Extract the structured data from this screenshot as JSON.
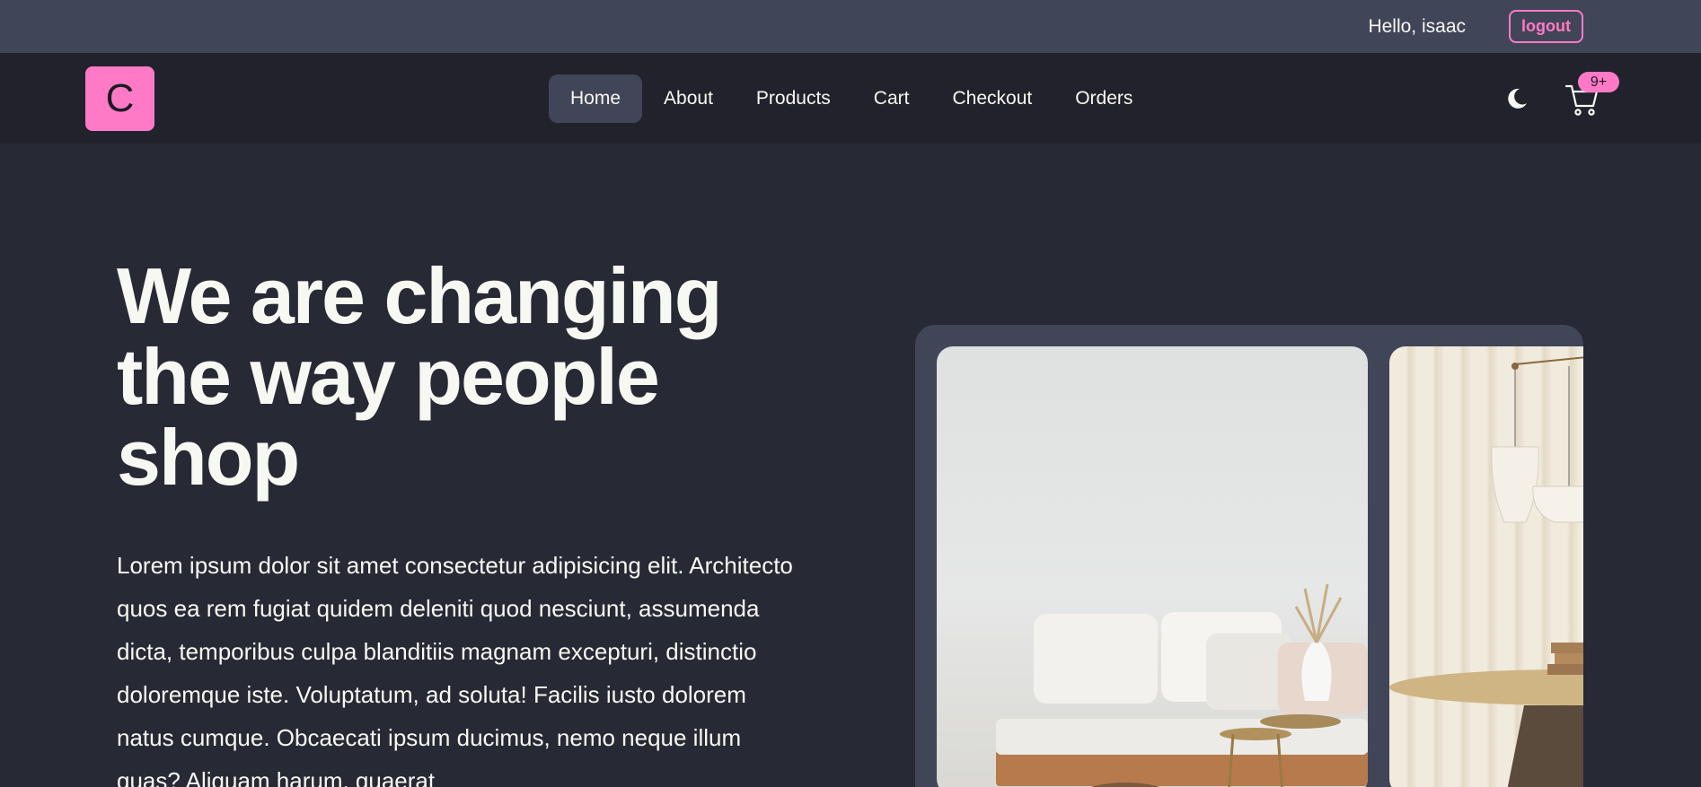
{
  "topbar": {
    "greeting": "Hello, isaac",
    "logout_label": "logout"
  },
  "navbar": {
    "logo_letter": "C",
    "links": [
      {
        "label": "Home",
        "active": true
      },
      {
        "label": "About",
        "active": false
      },
      {
        "label": "Products",
        "active": false
      },
      {
        "label": "Cart",
        "active": false
      },
      {
        "label": "Checkout",
        "active": false
      },
      {
        "label": "Orders",
        "active": false
      }
    ],
    "theme_icon": "moon-icon",
    "cart_icon": "cart-icon",
    "cart_badge": "9+"
  },
  "hero": {
    "title": "We are changing the way people shop",
    "text": "Lorem ipsum dolor sit amet consectetur adipisicing elit. Architecto quos ea rem fugiat quidem deleniti quod nesciunt, assumenda dicta, temporibus culpa blanditiis magnam excepturi, distinctio doloremque iste. Voluptatum, ad soluta! Facilis iusto dolorem natus cumque. Obcaecati ipsum ducimus, nemo neque illum quas? Aliquam harum, quaerat"
  },
  "colors": {
    "accent": "#ff7ac6",
    "background": "#272935",
    "navbar": "#21222c",
    "topbar": "#414558"
  }
}
